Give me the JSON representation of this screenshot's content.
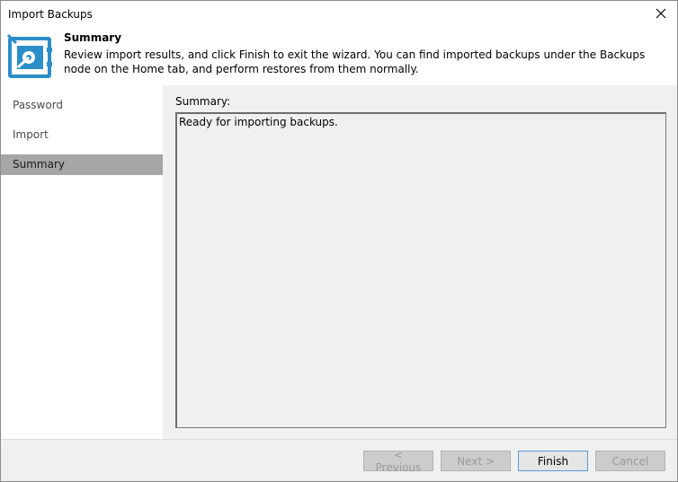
{
  "window": {
    "title": "Import Backups",
    "close_icon": "close-icon"
  },
  "header": {
    "icon": "vault-icon",
    "title": "Summary",
    "description": "Review import results, and click Finish to exit the wizard. You can find imported backups under the Backups node on the Home tab, and perform restores from them normally."
  },
  "sidebar": {
    "items": [
      {
        "label": "Password",
        "active": false
      },
      {
        "label": "Import",
        "active": false
      },
      {
        "label": "Summary",
        "active": true
      }
    ]
  },
  "content": {
    "summary_label": "Summary:",
    "summary_text": "Ready for importing backups."
  },
  "footer": {
    "previous_label": "< Previous",
    "next_label": "Next >",
    "finish_label": "Finish",
    "cancel_label": "Cancel"
  },
  "colors": {
    "accent": "#2c8ec9",
    "active_step_bg": "#a6a6a6",
    "panel_bg": "#f0f0f0"
  }
}
